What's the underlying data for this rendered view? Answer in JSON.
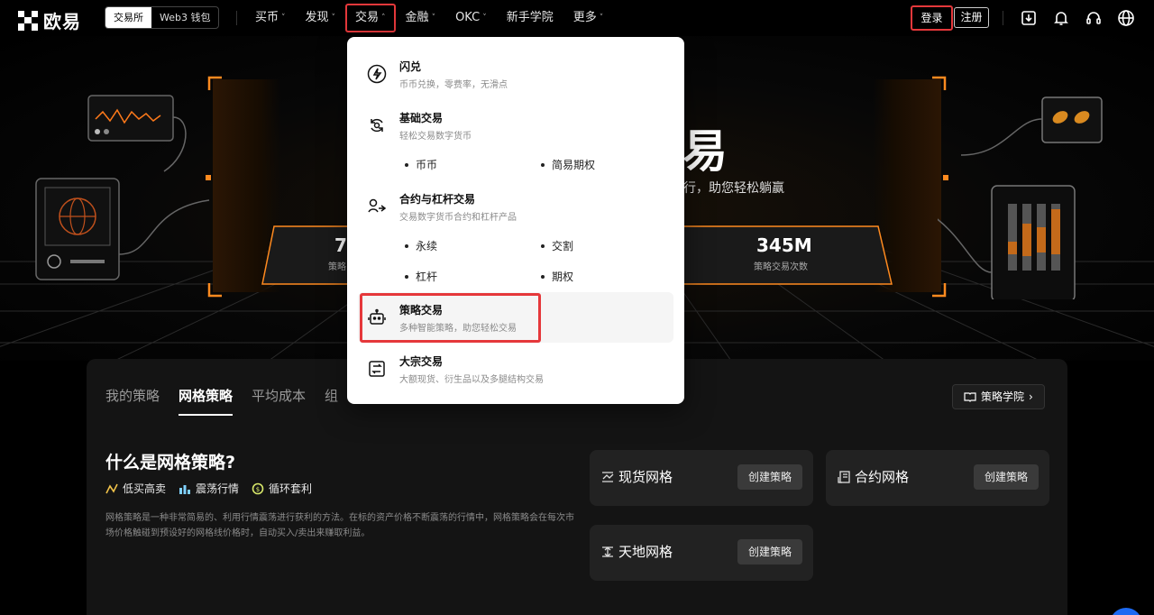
{
  "brand": {
    "name": "欧易"
  },
  "header": {
    "switch": {
      "exchange": "交易所",
      "wallet": "Web3 钱包"
    },
    "menu": [
      {
        "label": "买币",
        "chevron": "˅"
      },
      {
        "label": "发现",
        "chevron": "˅"
      },
      {
        "label": "交易",
        "chevron": "˄"
      },
      {
        "label": "金融",
        "chevron": "˅"
      },
      {
        "label": "OKC",
        "chevron": "˅"
      },
      {
        "label": "新手学院",
        "chevron": ""
      },
      {
        "label": "更多",
        "chevron": "˅"
      }
    ],
    "login": "登录",
    "register": "注册",
    "icons": [
      "download-icon",
      "bell-icon",
      "headset-icon",
      "globe-icon"
    ]
  },
  "hero": {
    "title_fragment": "易",
    "subtitle_fragment": "行，助您轻松躺赢",
    "stats": [
      {
        "value": "7",
        "label": "策略"
      },
      {
        "value": "345M",
        "label": "策略交易次数"
      }
    ]
  },
  "dropdown": {
    "items": [
      {
        "title": "闪兑",
        "desc": "币币兑换，零费率，无滑点",
        "icon": "flash-icon"
      },
      {
        "title": "基础交易",
        "desc": "轻松交易数字货币",
        "icon": "exchange-cycle-icon"
      },
      {
        "title": "合约与杠杆交易",
        "desc": "交易数字货币合约和杠杆产品",
        "icon": "contract-icon"
      },
      {
        "title": "策略交易",
        "desc": "多种智能策略，助您轻松交易",
        "icon": "robot-icon"
      },
      {
        "title": "大宗交易",
        "desc": "大额现货、衍生品以及多腿结构交易",
        "icon": "block-trade-icon"
      }
    ],
    "basic_sub": [
      "币币",
      "简易期权"
    ],
    "contract_sub": [
      "永续",
      "交割",
      "杠杆",
      "期权"
    ]
  },
  "panel": {
    "tabs": [
      "我的策略",
      "网格策略",
      "平均成本",
      "组"
    ],
    "active_tab": 1,
    "academy": "策略学院",
    "what_title": "什么是网格策略?",
    "features": [
      {
        "label": "低买高卖",
        "icon": "buy-low-sell-high-icon"
      },
      {
        "label": "震荡行情",
        "icon": "bar-chart-icon"
      },
      {
        "label": "循环套利",
        "icon": "cycle-coin-icon"
      }
    ],
    "description": "网格策略是一种非常简易的、利用行情震荡进行获利的方法。在标的资产价格不断震荡的行情中，网格策略会在每次市场价格触碰到预设好的网格线价格时，自动买入/卖出来赚取利益。",
    "cards": [
      {
        "title": "现货网格",
        "button": "创建策略",
        "icon": "spot-grid-icon"
      },
      {
        "title": "合约网格",
        "button": "创建策略",
        "icon": "contract-grid-icon"
      },
      {
        "title": "天地网格",
        "button": "创建策略",
        "icon": "infinity-grid-icon"
      }
    ]
  },
  "colors": {
    "accent_highlight": "#e5383b",
    "brand_orange": "#ff8a1f",
    "chat_blue": "#1d6af2"
  }
}
